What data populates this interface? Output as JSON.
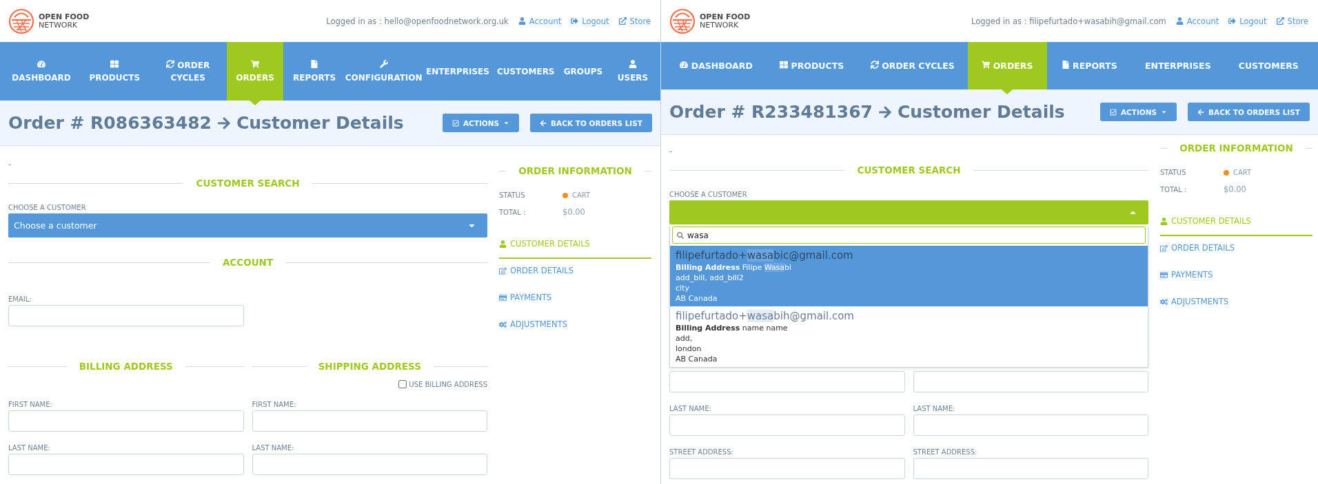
{
  "panes": [
    {
      "logo": {
        "line1": "OPEN FOOD",
        "line2": "NETWORK"
      },
      "logged_in": "Logged in as : hello@openfoodnetwork.org.uk",
      "user_links": [
        "Account",
        "Logout",
        "Store"
      ],
      "nav": [
        {
          "label": "DASHBOARD",
          "selected": false
        },
        {
          "label": "PRODUCTS",
          "selected": false
        },
        {
          "label": "ORDER CYCLES",
          "selected": false
        },
        {
          "label": "ORDERS",
          "selected": true
        },
        {
          "label": "REPORTS",
          "selected": false
        },
        {
          "label": "CONFIGURATION",
          "selected": false
        },
        {
          "label": "ENTERPRISES",
          "selected": false
        },
        {
          "label": "CUSTOMERS",
          "selected": false
        },
        {
          "label": "GROUPS",
          "selected": false
        },
        {
          "label": "USERS",
          "selected": false
        }
      ],
      "title": {
        "order": "Order # R086363482",
        "page": "Customer Details"
      },
      "buttons": [
        "ACTIONS",
        "BACK TO ORDERS LIST"
      ],
      "note": "-",
      "body": [
        {
          "kind": "heading",
          "text": "CUSTOMER SEARCH"
        },
        {
          "kind": "select",
          "label": "CHOOSE A CUSTOMER",
          "placeholder": "Choose a customer",
          "open": false
        },
        {
          "kind": "heading",
          "text": "ACCOUNT"
        },
        {
          "kind": "fields",
          "fields": [
            {
              "kind": "labeled",
              "label": "EMAIL:"
            }
          ]
        },
        {
          "kind": "headings",
          "texts": [
            "BILLING ADDRESS",
            "SHIPPING ADDRESS"
          ]
        },
        {
          "kind": "checkbox",
          "label": "USE BILLING ADDRESS",
          "checked": false
        },
        {
          "kind": "fields",
          "fields": [
            {
              "kind": "labeled",
              "label": "FIRST NAME:"
            },
            {
              "kind": "labeled",
              "label": "FIRST NAME:"
            }
          ]
        },
        {
          "kind": "fields",
          "fields": [
            {
              "kind": "labeled",
              "label": "LAST NAME:"
            },
            {
              "kind": "labeled",
              "label": "LAST NAME:"
            }
          ]
        }
      ],
      "sidebar": {
        "heading": "ORDER INFORMATION",
        "status_label": "STATUS",
        "status": {
          "text": "CART",
          "color": "#f68e1e"
        },
        "total_label": "TOTAL :",
        "total": "$0.00",
        "menu": [
          {
            "label": "CUSTOMER DETAILS",
            "selected": true
          },
          {
            "label": "ORDER DETAILS",
            "selected": false
          },
          {
            "label": "PAYMENTS",
            "selected": false
          },
          {
            "label": "ADJUSTMENTS",
            "selected": false
          }
        ]
      }
    },
    {
      "logo": {
        "line1": "OPEN FOOD",
        "line2": "NETWORK"
      },
      "logged_in": "Logged in as : filipefurtado+wasabih@gmail.com",
      "user_links": [
        "Account",
        "Logout",
        "Store"
      ],
      "nav": [
        {
          "label": "DASHBOARD",
          "selected": false
        },
        {
          "label": "PRODUCTS",
          "selected": false
        },
        {
          "label": "ORDER CYCLES",
          "selected": false
        },
        {
          "label": "ORDERS",
          "selected": true
        },
        {
          "label": "REPORTS",
          "selected": false
        },
        {
          "label": "ENTERPRISES",
          "selected": false
        },
        {
          "label": "CUSTOMERS",
          "selected": false
        }
      ],
      "title": {
        "order": "Order # R233481367",
        "page": "Customer Details"
      },
      "buttons": [
        "ACTIONS",
        "BACK TO ORDERS LIST"
      ],
      "note": "-",
      "body": [
        {
          "kind": "heading",
          "text": "CUSTOMER SEARCH"
        },
        {
          "kind": "select",
          "label": "CHOOSE A CUSTOMER",
          "open": true,
          "search": "wasa",
          "options": [
            {
              "selected": true,
              "email": [
                {
                  "text": "filipefurtado+",
                  "highlighted": false
                },
                {
                  "text": "wasa",
                  "highlighted": true
                },
                {
                  "text": "bic@gmail.com",
                  "highlighted": false
                }
              ],
              "billing": [
                {
                  "text": "Billing Address",
                  "bold": true,
                  "highlighted": false
                },
                {
                  "text": " Filipe ",
                  "bold": false,
                  "highlighted": false
                },
                {
                  "text": "Wasa",
                  "bold": false,
                  "highlighted": true
                },
                {
                  "text": "bi",
                  "bold": false,
                  "highlighted": false
                }
              ],
              "lines": [
                "add_bill, add_bill2",
                "city",
                "AB Canada"
              ]
            },
            {
              "selected": false,
              "email": [
                {
                  "text": "filipefurtado+",
                  "highlighted": false
                },
                {
                  "text": "wasa",
                  "highlighted": true
                },
                {
                  "text": "bih@gmail.com",
                  "highlighted": false
                }
              ],
              "billing": [
                {
                  "text": "Billing Address",
                  "bold": true,
                  "highlighted": false
                },
                {
                  "text": " name name",
                  "bold": false,
                  "highlighted": false
                }
              ],
              "lines": [
                "add,",
                "london",
                "AB Canada"
              ]
            }
          ]
        },
        {
          "kind": "fields",
          "fields": [
            {
              "kind": "bare"
            },
            {
              "kind": "bare"
            }
          ]
        },
        {
          "kind": "fields",
          "fields": [
            {
              "kind": "labeled",
              "label": "LAST NAME:"
            },
            {
              "kind": "labeled",
              "label": "LAST NAME:"
            }
          ]
        },
        {
          "kind": "fields",
          "fields": [
            {
              "kind": "labeled",
              "label": "STREET ADDRESS:"
            },
            {
              "kind": "labeled",
              "label": "STREET ADDRESS:"
            }
          ]
        }
      ],
      "sidebar": {
        "heading": "ORDER INFORMATION",
        "status_label": "STATUS",
        "status": {
          "text": "CART",
          "color": "#f68e1e"
        },
        "total_label": "TOTAL :",
        "total": "$0.00",
        "menu": [
          {
            "label": "CUSTOMER DETAILS",
            "selected": true
          },
          {
            "label": "ORDER DETAILS",
            "selected": false
          },
          {
            "label": "PAYMENTS",
            "selected": false
          },
          {
            "label": "ADJUSTMENTS",
            "selected": false
          }
        ]
      }
    }
  ]
}
